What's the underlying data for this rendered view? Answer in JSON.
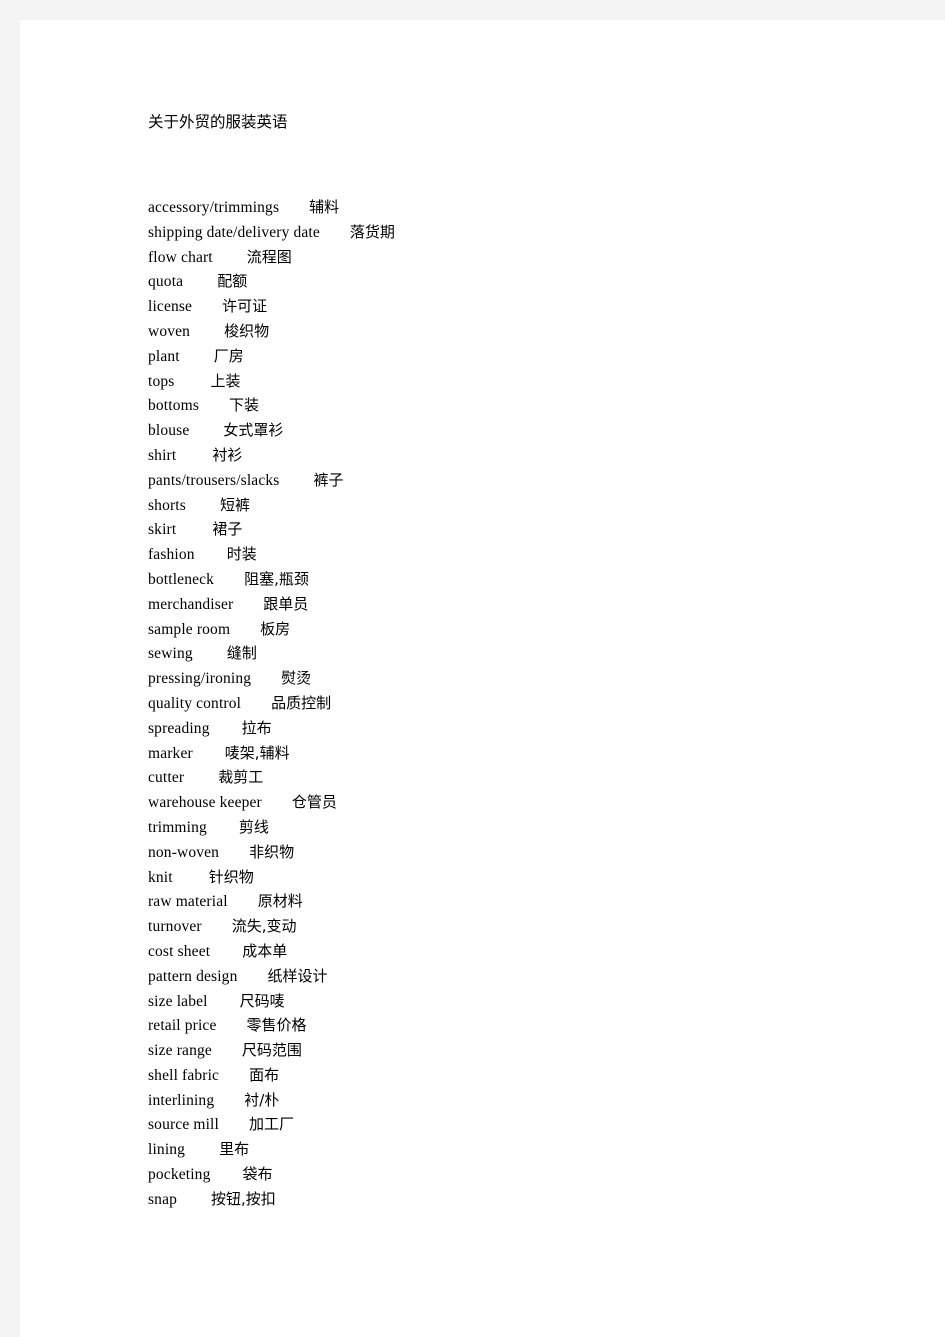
{
  "document": {
    "title": "关于外贸的服装英语",
    "glossary": [
      {
        "en": "accessory/trimmings",
        "zh": "辅料",
        "gap": 30
      },
      {
        "en": "shipping  date/delivery  date",
        "zh": "落货期",
        "gap": 30
      },
      {
        "en": "flow  chart",
        "zh": "流程图",
        "gap": 34
      },
      {
        "en": "quota",
        "zh": "配额",
        "gap": 34
      },
      {
        "en": "license",
        "zh": "许可证",
        "gap": 30
      },
      {
        "en": "woven",
        "zh": "梭织物",
        "gap": 34
      },
      {
        "en": "plant",
        "zh": "厂房",
        "gap": 34
      },
      {
        "en": "tops",
        "zh": "上装",
        "gap": 36
      },
      {
        "en": "bottoms",
        "zh": "下装",
        "gap": 30
      },
      {
        "en": "blouse",
        "zh": "女式罩衫",
        "gap": 34
      },
      {
        "en": "shirt",
        "zh": "衬衫",
        "gap": 36
      },
      {
        "en": "pants/trousers/slacks",
        "zh": "裤子",
        "gap": 34
      },
      {
        "en": "shorts",
        "zh": "短裤",
        "gap": 34
      },
      {
        "en": "skirt",
        "zh": "裙子",
        "gap": 36
      },
      {
        "en": "fashion",
        "zh": "时装",
        "gap": 32
      },
      {
        "en": "bottleneck",
        "zh": "阻塞,瓶颈",
        "gap": 30
      },
      {
        "en": "merchandiser",
        "zh": "跟单员",
        "gap": 30
      },
      {
        "en": "sample  room",
        "zh": "板房",
        "gap": 30
      },
      {
        "en": "sewing",
        "zh": "缝制",
        "gap": 34
      },
      {
        "en": "pressing/ironing",
        "zh": "熨烫",
        "gap": 30
      },
      {
        "en": "quality   control",
        "zh": "品质控制",
        "gap": 30
      },
      {
        "en": "spreading",
        "zh": "拉布",
        "gap": 32
      },
      {
        "en": "marker",
        "zh": "唛架,辅料",
        "gap": 32
      },
      {
        "en": "cutter",
        "zh": "裁剪工",
        "gap": 34
      },
      {
        "en": "warehouse  keeper",
        "zh": "仓管员",
        "gap": 30
      },
      {
        "en": "trimming",
        "zh": "剪线",
        "gap": 32
      },
      {
        "en": "non-woven",
        "zh": "非织物",
        "gap": 30
      },
      {
        "en": "knit",
        "zh": "针织物",
        "gap": 36
      },
      {
        "en": "raw  material",
        "zh": "原材料",
        "gap": 30
      },
      {
        "en": "turnover",
        "zh": "流失,变动",
        "gap": 30
      },
      {
        "en": "cost  sheet",
        "zh": "成本单",
        "gap": 32
      },
      {
        "en": "pattern  design",
        "zh": "纸样设计",
        "gap": 30
      },
      {
        "en": "size  label",
        "zh": "尺码唛",
        "gap": 32
      },
      {
        "en": "retail  price",
        "zh": "零售价格",
        "gap": 30
      },
      {
        "en": "size  range",
        "zh": "尺码范围",
        "gap": 30
      },
      {
        "en": "shell  fabric",
        "zh": "面布",
        "gap": 30
      },
      {
        "en": "interlining",
        "zh": "衬/朴",
        "gap": 30
      },
      {
        "en": "source  mill",
        "zh": "加工厂",
        "gap": 30
      },
      {
        "en": "lining",
        "zh": "里布",
        "gap": 34
      },
      {
        "en": "pocketing",
        "zh": "袋布",
        "gap": 32
      },
      {
        "en": "snap",
        "zh": "按钮,按扣",
        "gap": 34
      }
    ]
  }
}
